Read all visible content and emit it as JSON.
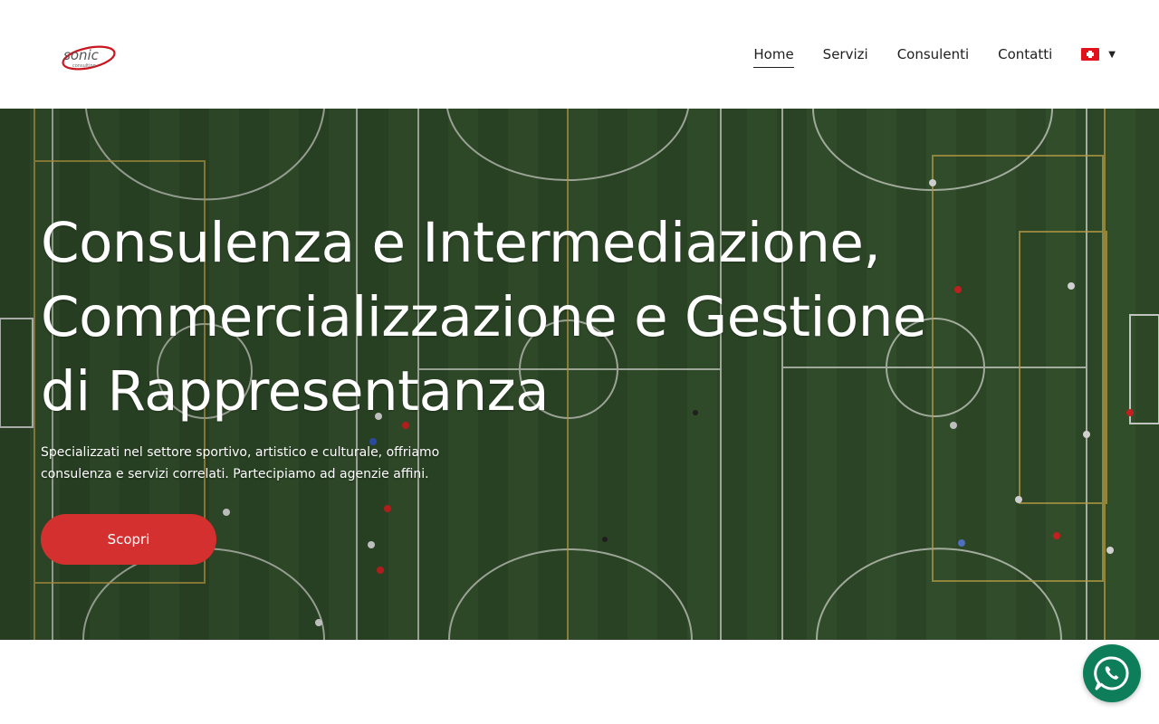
{
  "brand": {
    "logo_text": "sonic",
    "logo_subtext": "consulting",
    "logo_icon": "sonic-logo-icon"
  },
  "nav": {
    "items": [
      {
        "label": "Home",
        "active": true
      },
      {
        "label": "Servizi",
        "active": false
      },
      {
        "label": "Consulenti",
        "active": false
      },
      {
        "label": "Contatti",
        "active": false
      }
    ],
    "language_flag": "swiss-flag-icon",
    "language_caret": "▼"
  },
  "hero": {
    "title_line1": "Consulenza e Intermediazione,",
    "title_line2": "Commercializzazione e Gestione",
    "title_line3": "di Rappresentanza",
    "subtitle_line1": "Specializzati nel settore sportivo, artistico e culturale, offriamo",
    "subtitle_line2": "consulenza e servizi correlati. Partecipiamo ad agenzie affini.",
    "cta_label": "Scopri",
    "background": "aerial-soccer-fields-image"
  },
  "floating": {
    "whatsapp_icon": "whatsapp-icon"
  },
  "colors": {
    "accent": "#d53030",
    "whatsapp": "#0e7e5a",
    "field_green": "#2f4a29"
  }
}
